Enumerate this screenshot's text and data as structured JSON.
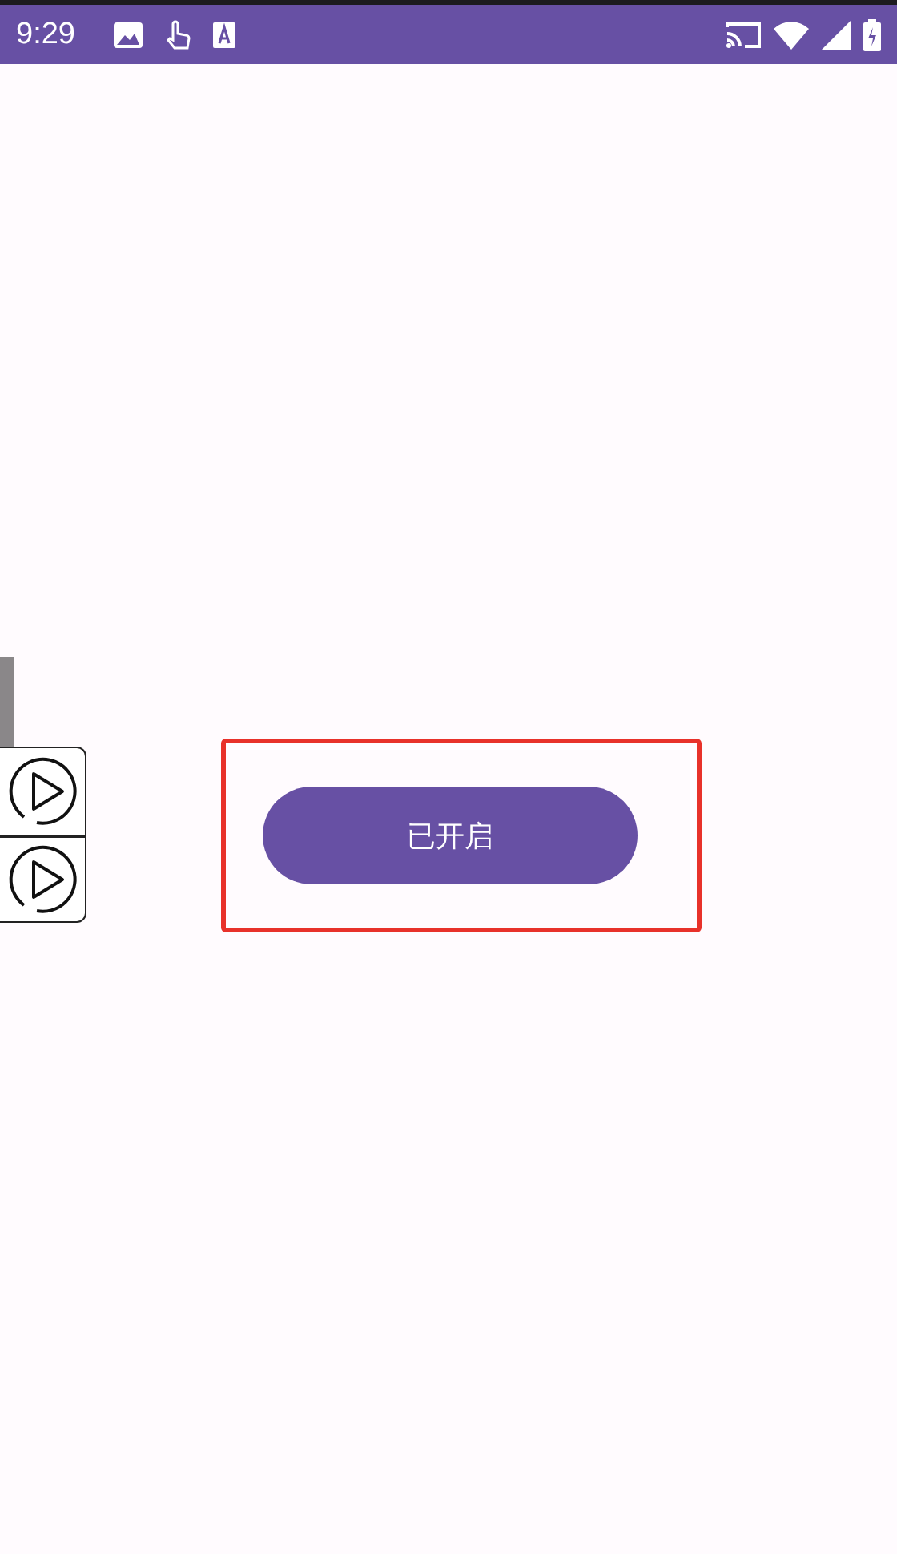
{
  "status_bar": {
    "time": "9:29"
  },
  "toggle_button": {
    "label": "已开启",
    "on": true
  },
  "floating_controls": [
    {
      "kind": "play"
    },
    {
      "kind": "play"
    }
  ]
}
